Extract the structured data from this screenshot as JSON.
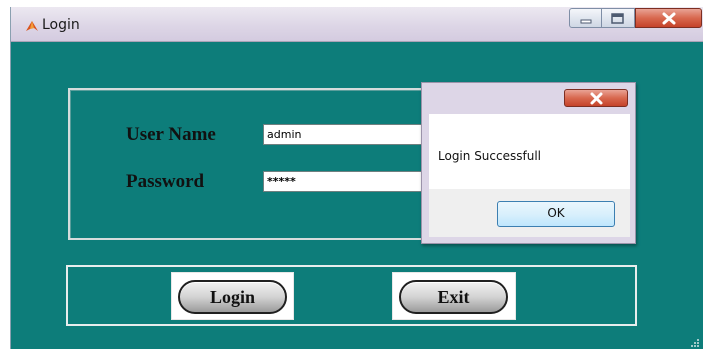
{
  "window": {
    "title": "Login",
    "app_icon": "matlab-icon",
    "caption_buttons": [
      "minimize-icon",
      "maximize-icon",
      "close-icon"
    ]
  },
  "form": {
    "username_label": "User Name",
    "username_value": "admin",
    "password_label": "Password",
    "password_value": "*****"
  },
  "buttons": {
    "login_label": "Login",
    "exit_label": "Exit"
  },
  "dialog": {
    "message": "Login Successfull",
    "ok_label": "OK"
  },
  "colors": {
    "window_background": "#0d7d7a",
    "titlebar": "#ddd6e6",
    "close_button": "#d8684f"
  }
}
